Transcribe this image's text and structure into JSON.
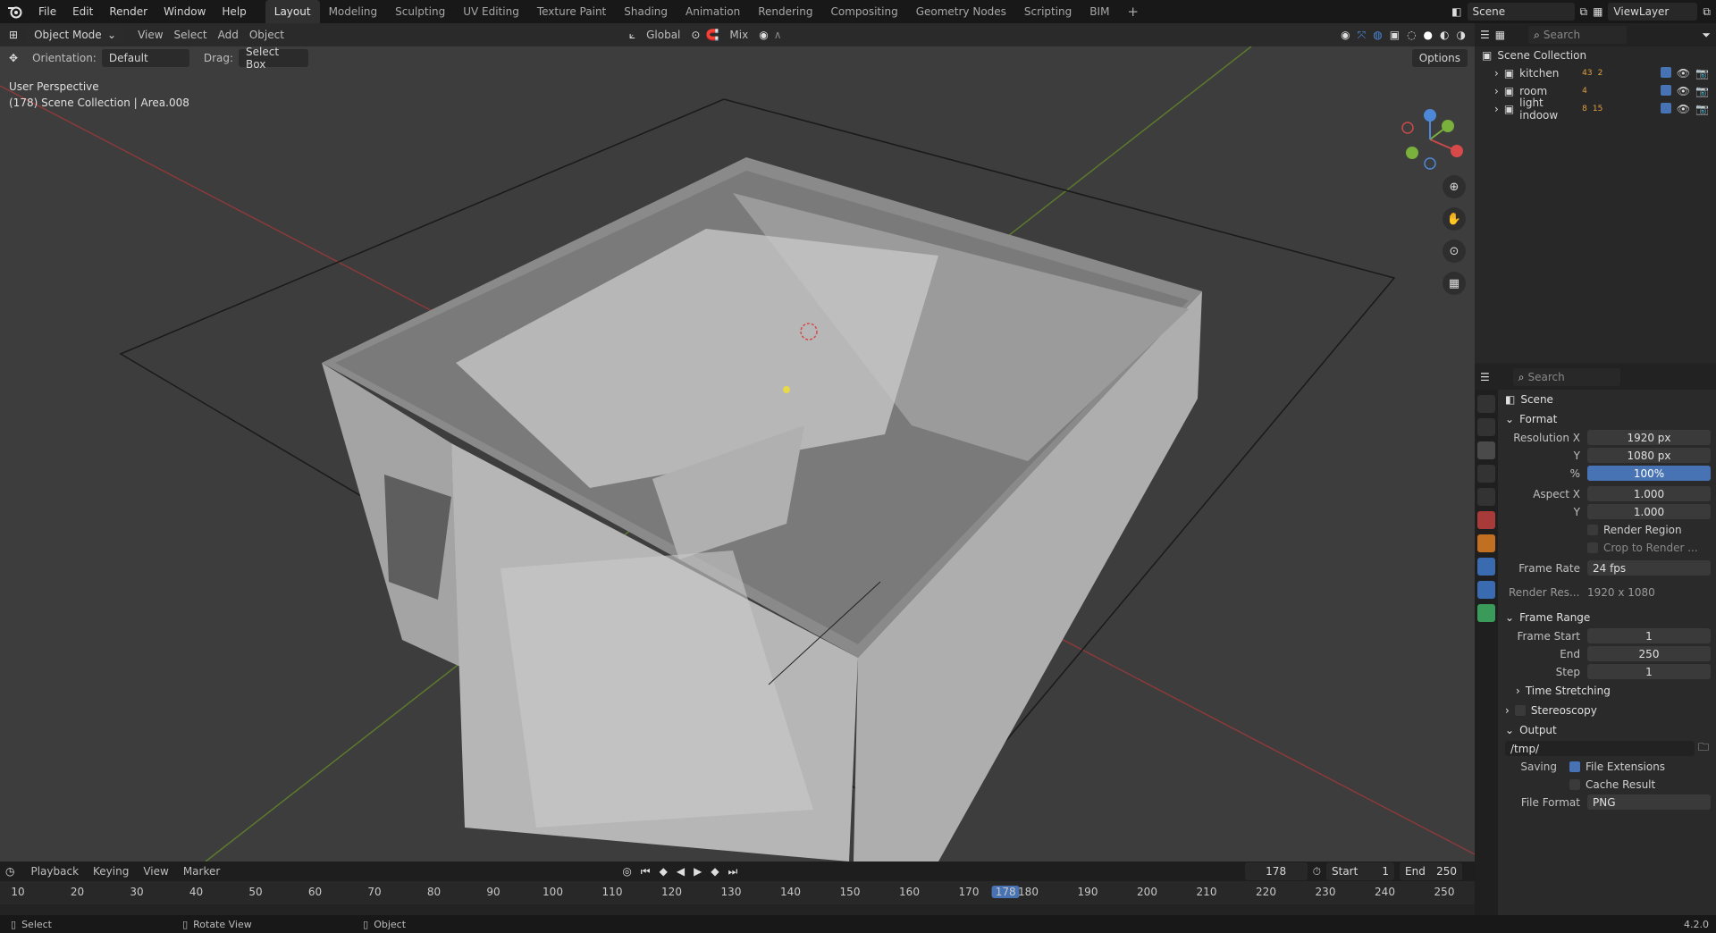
{
  "menu": {
    "file": "File",
    "edit": "Edit",
    "render": "Render",
    "window": "Window",
    "help": "Help"
  },
  "workspaces": [
    "Layout",
    "Modeling",
    "Sculpting",
    "UV Editing",
    "Texture Paint",
    "Shading",
    "Animation",
    "Rendering",
    "Compositing",
    "Geometry Nodes",
    "Scripting",
    "BIM"
  ],
  "top_right": {
    "scene": "Scene",
    "view_layer": "ViewLayer"
  },
  "viewport_header": {
    "mode": "Object Mode",
    "view": "View",
    "select": "Select",
    "add": "Add",
    "object": "Object",
    "transform": "Global",
    "pivot": "Mix"
  },
  "toolbar": {
    "orientation_label": "Orientation:",
    "orientation": "Default",
    "drag_label": "Drag:",
    "drag": "Select Box",
    "options": "Options"
  },
  "viewport_info": {
    "view_name": "User Perspective",
    "scene_path": "(178) Scene Collection | Area.008"
  },
  "outliner": {
    "search_placeholder": "Search",
    "root": "Scene Collection",
    "items": [
      {
        "name": "kitchen",
        "count1": "43",
        "count2": "2"
      },
      {
        "name": "room",
        "count1": "4",
        "count2": ""
      },
      {
        "name": "light indoow",
        "count1": "8",
        "count2": "15"
      }
    ]
  },
  "properties": {
    "search_placeholder": "Search",
    "context": "Scene",
    "format_label": "Format",
    "res_x_label": "Resolution X",
    "res_x": "1920 px",
    "res_y_label": "Y",
    "res_y": "1080 px",
    "res_pct_label": "%",
    "res_pct": "100%",
    "aspect_x_label": "Aspect X",
    "aspect_x": "1.000",
    "aspect_y_label": "Y",
    "aspect_y": "1.000",
    "render_region": "Render Region",
    "crop": "Crop to Render ...",
    "frame_rate_label": "Frame Rate",
    "frame_rate": "24 fps",
    "render_res_label": "Render Res...",
    "render_res": "1920 x 1080",
    "frame_range_label": "Frame Range",
    "frame_start_label": "Frame Start",
    "frame_start": "1",
    "end_label": "End",
    "end": "250",
    "step_label": "Step",
    "step": "1",
    "time_stretching": "Time Stretching",
    "stereoscopy": "Stereoscopy",
    "output_label": "Output",
    "output_path": "/tmp/",
    "saving_label": "Saving",
    "file_extensions": "File Extensions",
    "cache_result": "Cache Result",
    "file_format_label": "File Format",
    "file_format": "PNG"
  },
  "timeline": {
    "playback": "Playback",
    "keying": "Keying",
    "view": "View",
    "marker": "Marker",
    "current": "178",
    "start_label": "Start",
    "start": "1",
    "end_label": "End",
    "end": "250",
    "ticks": [
      "10",
      "20",
      "30",
      "40",
      "50",
      "60",
      "70",
      "80",
      "90",
      "100",
      "110",
      "120",
      "130",
      "140",
      "150",
      "160",
      "170",
      "180",
      "190",
      "200",
      "210",
      "220",
      "230",
      "240",
      "250"
    ],
    "cursor": "178"
  },
  "status": {
    "select": "Select",
    "rotate": "Rotate View",
    "object": "Object",
    "version": "4.2.0"
  }
}
